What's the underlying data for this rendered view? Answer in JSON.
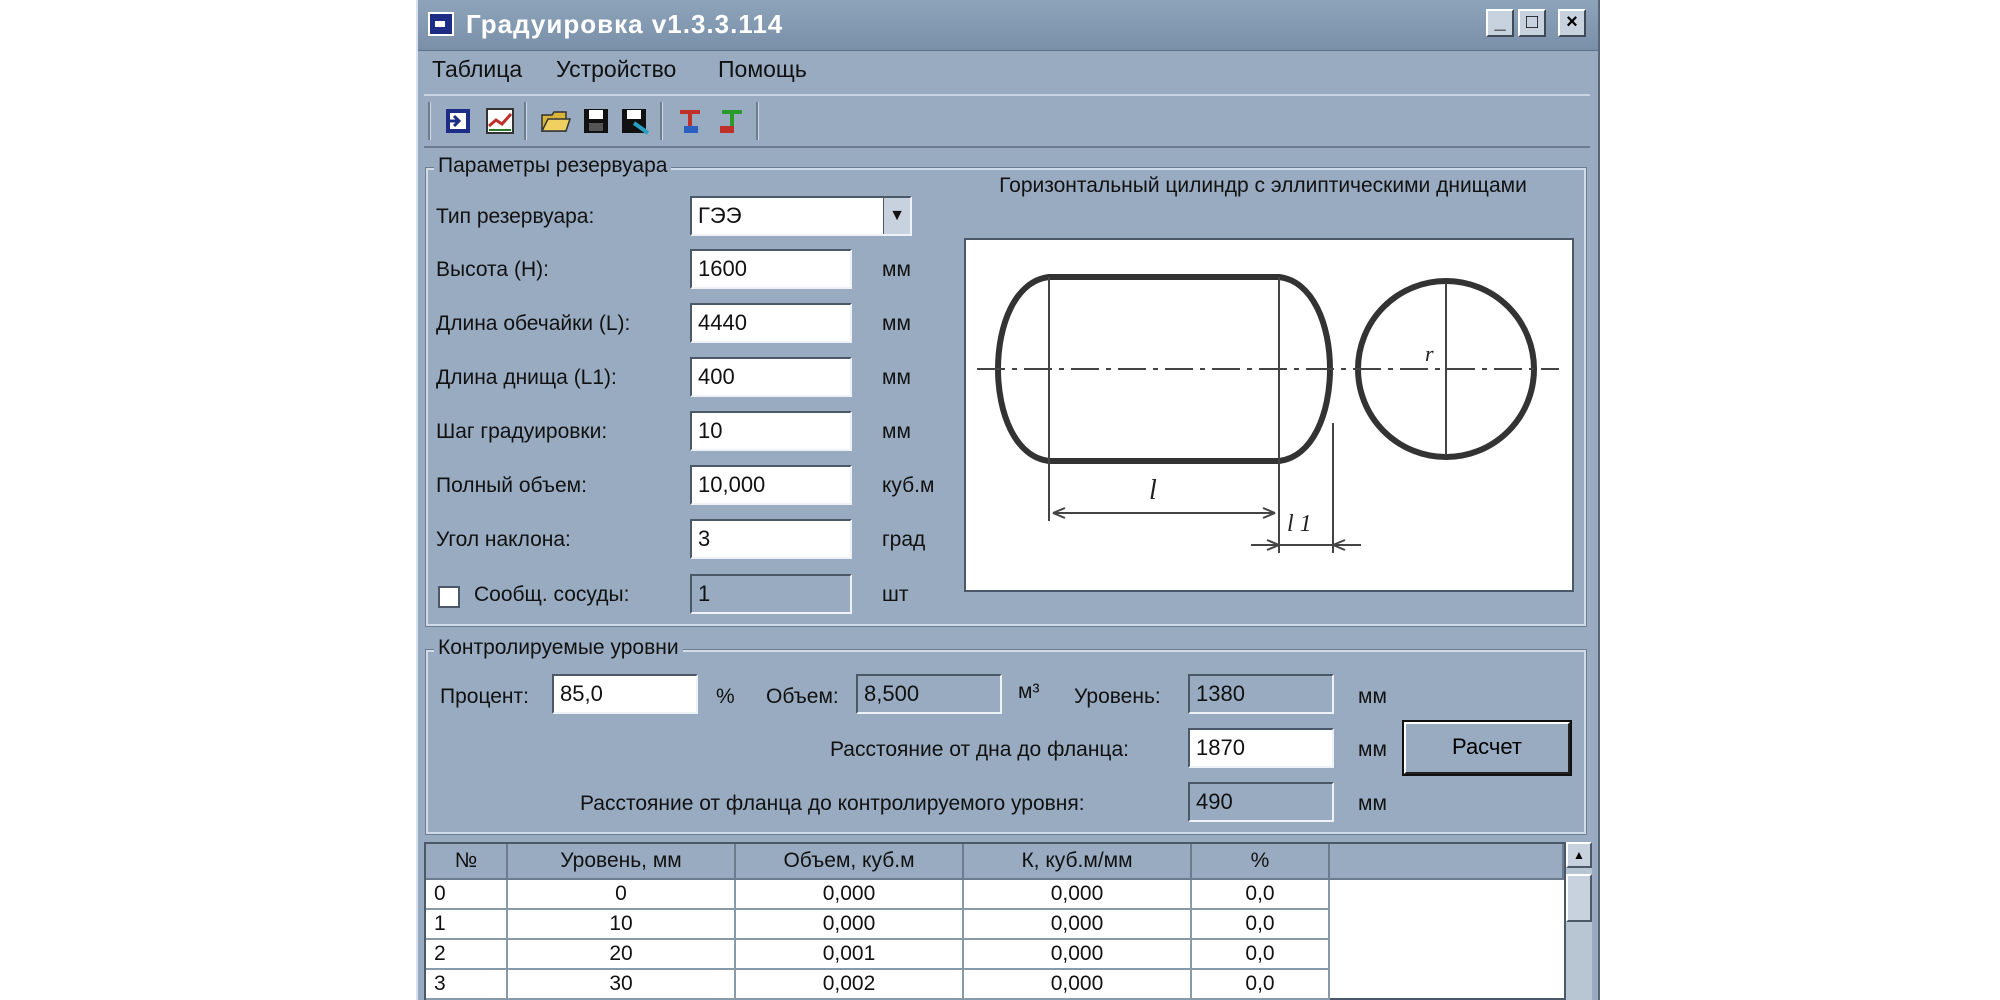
{
  "window": {
    "title": "Градуировка v1.3.3.114",
    "minimize": "_",
    "maximize": "□",
    "close": "×"
  },
  "menu": [
    "Таблица",
    "Устройство",
    "Помощь"
  ],
  "toolbar_icons": [
    "exit-icon",
    "chart-icon",
    "open-folder-icon",
    "save-icon",
    "save-as-icon",
    "device-read-icon",
    "device-write-icon"
  ],
  "tank_params": {
    "title": "Параметры резервуара",
    "type_label": "Тип резервуара:",
    "type_value": "ГЭЭ",
    "height_label": "Высота (H):",
    "height_value": "1600",
    "height_unit": "мм",
    "shell_label": "Длина обечайки (L):",
    "shell_value": "4440",
    "shell_unit": "мм",
    "head_label": "Длина днища (L1):",
    "head_value": "400",
    "head_unit": "мм",
    "step_label": "Шаг градуировки:",
    "step_value": "10",
    "step_unit": "мм",
    "volume_label": "Полный объем:",
    "volume_value": "10,000",
    "volume_unit": "куб.м",
    "angle_label": "Угол наклона:",
    "angle_value": "3",
    "angle_unit": "град",
    "vessels_label": "Сообщ. сосуды:",
    "vessels_value": "1",
    "vessels_unit": "шт"
  },
  "diagram": {
    "title": "Горизонтальный цилиндр с эллиптическими днищами",
    "label_l": "l",
    "label_l1": "l 1",
    "label_r": "r"
  },
  "levels": {
    "title": "Контролируемые уровни",
    "percent_label": "Процент:",
    "percent_value": "85,0",
    "percent_unit": "%",
    "volume_label": "Объем:",
    "volume_value": "8,500",
    "volume_unit": "м³",
    "level_label": "Уровень:",
    "level_value": "1380",
    "level_unit": "мм",
    "flange_label": "Расстояние от дна до фланца:",
    "flange_value": "1870",
    "flange_unit": "мм",
    "calc_button": "Расчет",
    "control_label": "Расстояние от фланца до контролируемого уровня:",
    "control_value": "490",
    "control_unit": "мм"
  },
  "table": {
    "headers": [
      "№",
      "Уровень, мм",
      "Объем, куб.м",
      "К, куб.м/мм",
      "%"
    ],
    "rows": [
      [
        "0",
        "0",
        "0,000",
        "0,000",
        "0,0"
      ],
      [
        "1",
        "10",
        "0,000",
        "0,000",
        "0,0"
      ],
      [
        "2",
        "20",
        "0,001",
        "0,000",
        "0,0"
      ],
      [
        "3",
        "30",
        "0,002",
        "0,000",
        "0,0"
      ]
    ]
  }
}
